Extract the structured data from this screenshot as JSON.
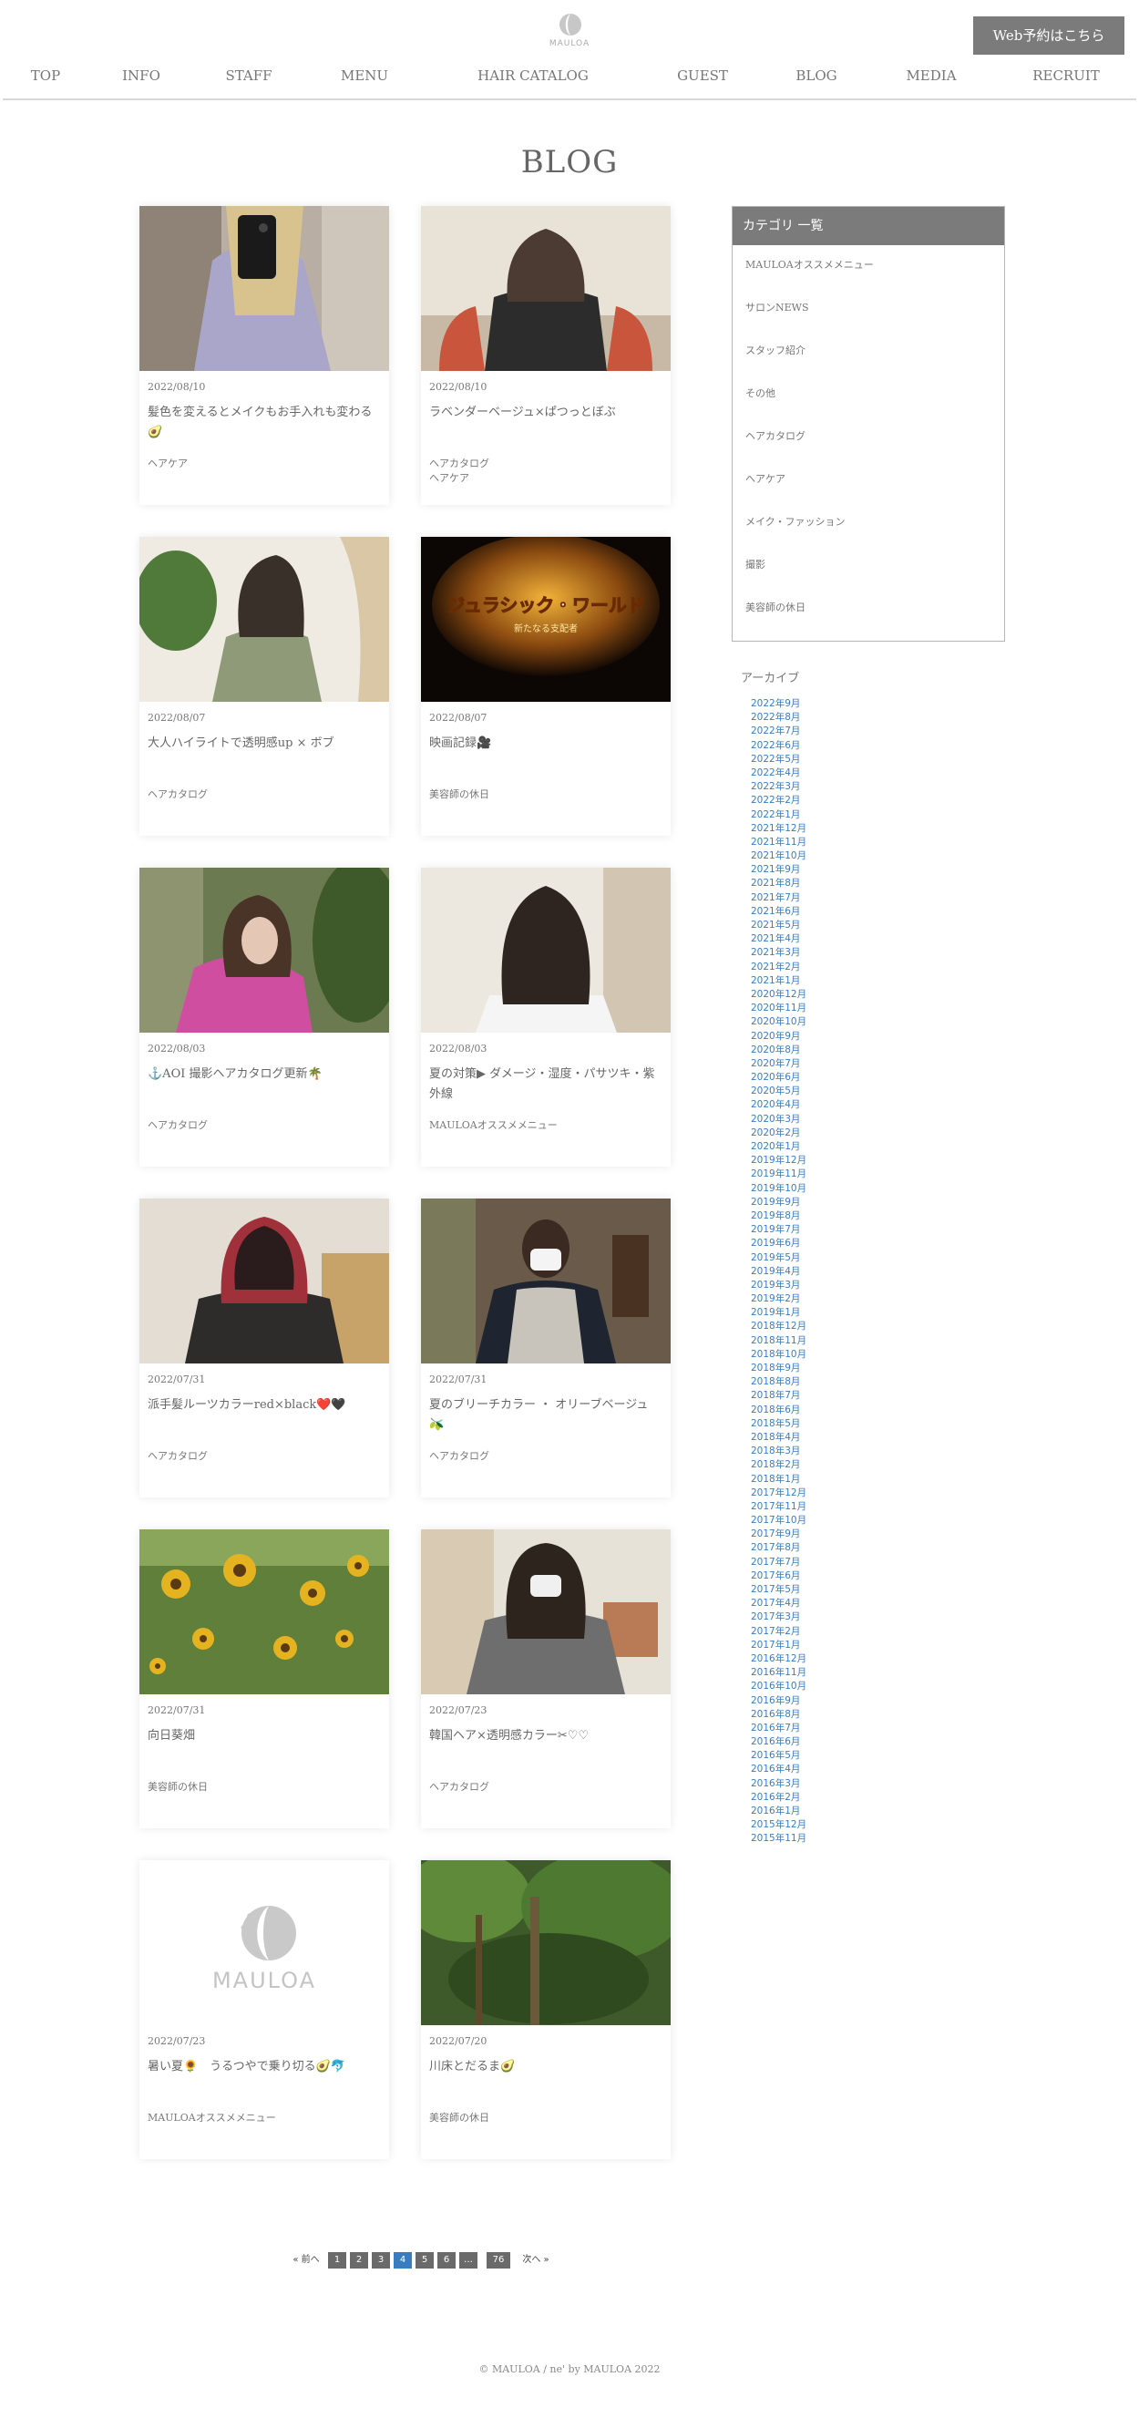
{
  "brand": {
    "logo_text": "MAULOA"
  },
  "header": {
    "reserve_label": "Web予約はこちら"
  },
  "nav": [
    {
      "label": "TOP"
    },
    {
      "label": "INFO"
    },
    {
      "label": "STAFF"
    },
    {
      "label": "MENU"
    },
    {
      "label": "HAIR CATALOG"
    },
    {
      "label": "GUEST"
    },
    {
      "label": "BLOG"
    },
    {
      "label": "MEDIA"
    },
    {
      "label": "RECRUIT"
    }
  ],
  "page": {
    "title": "BLOG"
  },
  "posts": [
    {
      "date": "2022/08/10",
      "title": "髪色を変えるとメイクもお手入れも変わる🥑",
      "categories": [
        "ヘアケア"
      ],
      "image": "mirror-selfie"
    },
    {
      "date": "2022/08/10",
      "title": "ラベンダーベージュ×ぱつっとぼぶ",
      "categories": [
        "ヘアカタログ",
        "ヘアケア"
      ],
      "image": "back-bob"
    },
    {
      "date": "2022/08/07",
      "title": "大人ハイライトで透明感up × ボブ",
      "categories": [
        "ヘアカタログ"
      ],
      "image": "side-bob"
    },
    {
      "date": "2022/08/07",
      "title": "映画記録🎥",
      "categories": [
        "美容師の休日"
      ],
      "image": "movie-poster",
      "poster_text": "ジュラシック・ワールド",
      "poster_sub": "新たなる支配者"
    },
    {
      "date": "2022/08/03",
      "title": "⚓AOI 撮影ヘアカタログ更新🌴",
      "categories": [
        "ヘアカタログ"
      ],
      "image": "pink-model"
    },
    {
      "date": "2022/08/03",
      "title": "夏の対策▶ ダメージ・湿度・パサツキ・紫外線",
      "categories": [
        "MAULOAオススメメニュー"
      ],
      "image": "long-straight"
    },
    {
      "date": "2022/07/31",
      "title": "派手髪ルーツカラーred×black❤️🖤",
      "categories": [
        "ヘアカタログ"
      ],
      "image": "red-roots"
    },
    {
      "date": "2022/07/31",
      "title": "夏のブリーチカラー ・ オリーブベージュ🫒",
      "categories": [
        "ヘアカタログ"
      ],
      "image": "mask-apron"
    },
    {
      "date": "2022/07/31",
      "title": "向日葵畑",
      "categories": [
        "美容師の休日"
      ],
      "image": "sunflowers"
    },
    {
      "date": "2022/07/23",
      "title": "韓国ヘア×透明感カラー✂︎♡♡",
      "categories": [
        "ヘアカタログ"
      ],
      "image": "mask-plaid"
    },
    {
      "date": "2022/07/23",
      "title": "暑い夏🌻　うるつやで乗り切る🥑🐬",
      "categories": [
        "MAULOAオススメメニュー"
      ],
      "image": "logo-placeholder"
    },
    {
      "date": "2022/07/20",
      "title": "川床とだるま🥑",
      "categories": [
        "美容師の休日"
      ],
      "image": "forest"
    }
  ],
  "sidebar": {
    "category_title": "カテゴリ 一覧",
    "categories": [
      "MAULOAオススメメニュー",
      "サロンNEWS",
      "スタッフ紹介",
      "その他",
      "ヘアカタログ",
      "ヘアケア",
      "メイク・ファッション",
      "撮影",
      "美容師の休日"
    ],
    "archive_title": "アーカイブ",
    "archives": [
      "2022年9月",
      "2022年8月",
      "2022年7月",
      "2022年6月",
      "2022年5月",
      "2022年4月",
      "2022年3月",
      "2022年2月",
      "2022年1月",
      "2021年12月",
      "2021年11月",
      "2021年10月",
      "2021年9月",
      "2021年8月",
      "2021年7月",
      "2021年6月",
      "2021年5月",
      "2021年4月",
      "2021年3月",
      "2021年2月",
      "2021年1月",
      "2020年12月",
      "2020年11月",
      "2020年10月",
      "2020年9月",
      "2020年8月",
      "2020年7月",
      "2020年6月",
      "2020年5月",
      "2020年4月",
      "2020年3月",
      "2020年2月",
      "2020年1月",
      "2019年12月",
      "2019年11月",
      "2019年10月",
      "2019年9月",
      "2019年8月",
      "2019年7月",
      "2019年6月",
      "2019年5月",
      "2019年4月",
      "2019年3月",
      "2019年2月",
      "2019年1月",
      "2018年12月",
      "2018年11月",
      "2018年10月",
      "2018年9月",
      "2018年8月",
      "2018年7月",
      "2018年6月",
      "2018年5月",
      "2018年4月",
      "2018年3月",
      "2018年2月",
      "2018年1月",
      "2017年12月",
      "2017年11月",
      "2017年10月",
      "2017年9月",
      "2017年8月",
      "2017年7月",
      "2017年6月",
      "2017年5月",
      "2017年4月",
      "2017年3月",
      "2017年2月",
      "2017年1月",
      "2016年12月",
      "2016年11月",
      "2016年10月",
      "2016年9月",
      "2016年8月",
      "2016年7月",
      "2016年6月",
      "2016年5月",
      "2016年4月",
      "2016年3月",
      "2016年2月",
      "2016年1月",
      "2015年12月",
      "2015年11月"
    ]
  },
  "pagination": {
    "prev": "« 前へ",
    "next": "次へ »",
    "pages": [
      "1",
      "2",
      "3",
      "4",
      "5",
      "6",
      "…",
      "76"
    ],
    "current": "4"
  },
  "footer": {
    "copyright": "© MAULOA / ne' by MAULOA 2022"
  },
  "colors": {
    "button": "#7b7b7b",
    "link": "#3a7cc0",
    "text": "#666666"
  }
}
